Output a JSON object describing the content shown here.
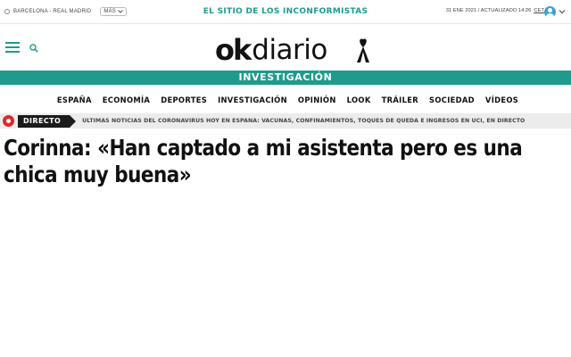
{
  "topbar": {
    "match": "BARCELONA - REAL MADRID",
    "more": "MÁS",
    "tagline": "EL SITIO DE LOS INCONFORMISTAS",
    "date": "31 ENE 2021 / ACTUALIZADO 14:26",
    "timezone": "CET"
  },
  "logo": {
    "ok": "ok",
    "name": "diario"
  },
  "section": {
    "label": "INVESTIGACIÓN"
  },
  "nav": {
    "items": [
      "ESPAÑA",
      "ECONOMÍA",
      "DEPORTES",
      "INVESTIGACIÓN",
      "OPINIÓN",
      "LOOK",
      "TRÁILER",
      "SOCIEDAD",
      "VÍDEOS"
    ]
  },
  "live": {
    "tag": "DIRECTO",
    "text": "ÚLTIMAS NOTICIAS DEL CORONAVIRUS HOY EN ESPAÑA: VACUNAS, CONFINAMIENTOS, TOQUES DE QUEDA E INGRESOS EN UCI, EN DIRECTO"
  },
  "article": {
    "headline": "Corinna: «Han captado a mi asistenta pero es una chica muy buena»"
  },
  "colors": {
    "brand": "#1f9b8c",
    "live_red": "#e0262d",
    "user_icon": "#3aa0cc"
  }
}
